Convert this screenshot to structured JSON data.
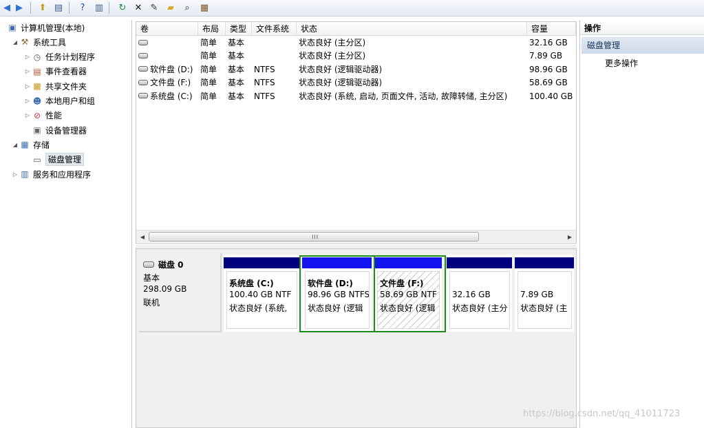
{
  "toolbar": {
    "buttons": [
      {
        "name": "back-arrow-icon",
        "glyph": "◀",
        "color": "#2d73d2"
      },
      {
        "name": "forward-arrow-icon",
        "glyph": "▶",
        "color": "#2d73d2"
      },
      {
        "name": "up-folder-icon",
        "glyph": "⬆",
        "color": "#c79a1c"
      },
      {
        "name": "show-hide-tree-icon",
        "glyph": "▤",
        "color": "#3d5f8c"
      },
      {
        "name": "help-icon",
        "glyph": "?",
        "color": "#2a4fa0"
      },
      {
        "name": "show-hide-action-icon",
        "glyph": "▥",
        "color": "#3d5f8c"
      },
      {
        "name": "refresh-icon",
        "glyph": "↻",
        "color": "#1f8a3a"
      },
      {
        "name": "delete-icon",
        "glyph": "✕",
        "color": "#111111"
      },
      {
        "name": "properties-icon",
        "glyph": "✎",
        "color": "#333333"
      },
      {
        "name": "open-folder-icon",
        "glyph": "▰",
        "color": "#d7a52a"
      },
      {
        "name": "search-icon",
        "glyph": "⌕",
        "color": "#2b2b2b"
      },
      {
        "name": "wizard-icon",
        "glyph": "▦",
        "color": "#7a5a2a"
      }
    ]
  },
  "tree": {
    "items": [
      {
        "name": "tree-root-computer-management",
        "label": "计算机管理(本地)",
        "indent": 0,
        "expander": "",
        "icon": "▣",
        "icon_color": "#3a6db5"
      },
      {
        "name": "tree-system-tools",
        "label": "系统工具",
        "indent": 1,
        "expander": "◢",
        "icon": "⚒",
        "icon_color": "#8a6a2a"
      },
      {
        "name": "tree-task-scheduler",
        "label": "任务计划程序",
        "indent": 2,
        "expander": "▷",
        "icon": "◷",
        "icon_color": "#555555"
      },
      {
        "name": "tree-event-viewer",
        "label": "事件查看器",
        "indent": 2,
        "expander": "▷",
        "icon": "▤",
        "icon_color": "#b84a2a"
      },
      {
        "name": "tree-shared-folders",
        "label": "共享文件夹",
        "indent": 2,
        "expander": "▷",
        "icon": "▩",
        "icon_color": "#c79a1c"
      },
      {
        "name": "tree-local-users",
        "label": "本地用户和组",
        "indent": 2,
        "expander": "▷",
        "icon": "☻",
        "icon_color": "#3a6db5"
      },
      {
        "name": "tree-performance",
        "label": "性能",
        "indent": 2,
        "expander": "▷",
        "icon": "⊘",
        "icon_color": "#b83a3a"
      },
      {
        "name": "tree-device-manager",
        "label": "设备管理器",
        "indent": 2,
        "expander": "",
        "icon": "▣",
        "icon_color": "#666666"
      },
      {
        "name": "tree-storage",
        "label": "存储",
        "indent": 1,
        "expander": "◢",
        "icon": "▦",
        "icon_color": "#3a6db5"
      },
      {
        "name": "tree-disk-management",
        "label": "磁盘管理",
        "indent": 2,
        "expander": "",
        "icon": "▭",
        "icon_color": "#555555",
        "selected": true
      },
      {
        "name": "tree-services-apps",
        "label": "服务和应用程序",
        "indent": 1,
        "expander": "▷",
        "icon": "▥",
        "icon_color": "#3a6db5"
      }
    ]
  },
  "volumes": {
    "columns": [
      "卷",
      "布局",
      "类型",
      "文件系统",
      "状态",
      "容量"
    ],
    "rows": [
      {
        "volume": "",
        "layout": "简单",
        "type": "基本",
        "fs": "",
        "status": "状态良好 (主分区)",
        "capacity": "32.16 GB"
      },
      {
        "volume": "",
        "layout": "简单",
        "type": "基本",
        "fs": "",
        "status": "状态良好 (主分区)",
        "capacity": "7.89 GB"
      },
      {
        "volume": "软件盘 (D:)",
        "layout": "简单",
        "type": "基本",
        "fs": "NTFS",
        "status": "状态良好 (逻辑驱动器)",
        "capacity": "98.96 GB"
      },
      {
        "volume": "文件盘 (F:)",
        "layout": "简单",
        "type": "基本",
        "fs": "NTFS",
        "status": "状态良好 (逻辑驱动器)",
        "capacity": "58.69 GB"
      },
      {
        "volume": "系统盘 (C:)",
        "layout": "简单",
        "type": "基本",
        "fs": "NTFS",
        "status": "状态良好 (系统, 启动, 页面文件, 活动, 故障转储, 主分区)",
        "capacity": "100.40 GB"
      }
    ],
    "scroll_grip": "III"
  },
  "disk0": {
    "name": "磁盘 0",
    "type": "基本",
    "size": "298.09 GB",
    "state": "联机",
    "partitions": [
      {
        "title": "系统盘  (C:)",
        "size": "100.40 GB NTF",
        "status": "状态良好 (系统,",
        "bar_color": "#00007f",
        "selected": false,
        "hatched": false
      },
      {
        "title": "软件盘  (D:)",
        "size": "98.96 GB NTFS",
        "status": "状态良好 (逻辑",
        "bar_color": "#1414f0",
        "selected": true,
        "hatched": false
      },
      {
        "title": "文件盘  (F:)",
        "size": "58.69 GB NTF",
        "status": "状态良好 (逻辑",
        "bar_color": "#1414f0",
        "selected": true,
        "hatched": true
      },
      {
        "title": "",
        "size": "32.16 GB",
        "status": "状态良好 (主分",
        "bar_color": "#00007f",
        "selected": false,
        "hatched": false
      },
      {
        "title": "",
        "size": "7.89 GB",
        "status": "状态良好 (主",
        "bar_color": "#00007f",
        "selected": false,
        "hatched": false
      }
    ]
  },
  "actions": {
    "header": "操作",
    "section": "磁盘管理",
    "item": "更多操作"
  },
  "watermark": "https://blog.csdn.net/qq_41011723"
}
